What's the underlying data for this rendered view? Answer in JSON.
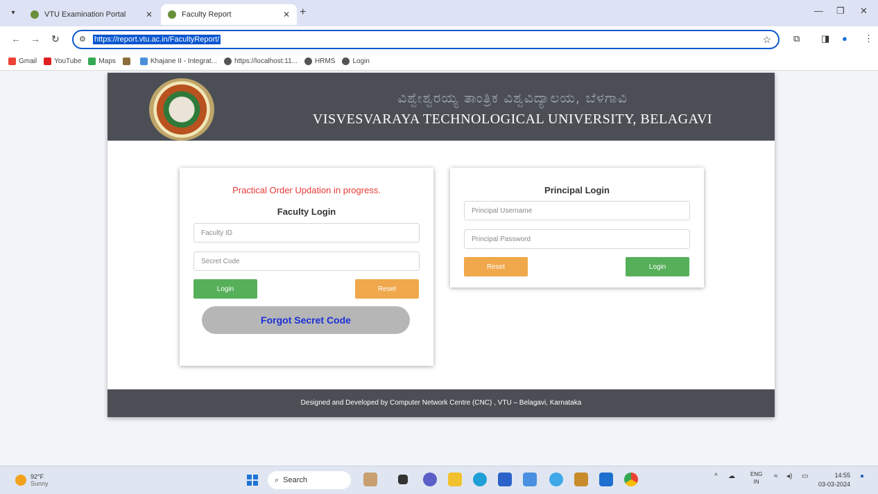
{
  "browser": {
    "tabs": [
      {
        "title": "VTU Examination Portal",
        "active": false
      },
      {
        "title": "Faculty Report",
        "active": true
      }
    ],
    "url": "https://report.vtu.ac.in/FacultyReport/",
    "bookmarks": [
      "Gmail",
      "YouTube",
      "Maps",
      "",
      "Khajane II - Integrat...",
      "https://localhost:11...",
      "HRMS",
      "Login"
    ]
  },
  "header": {
    "kannada_title": "ವಿಶ್ವೇಶ್ವರಯ್ಯ ತಾಂತ್ರಿಕ ವಿಶ್ವವಿದ್ಯಾಲಯ, ಬೆಳಗಾವಿ",
    "title": "VISVESVARAYA TECHNOLOGICAL UNIVERSITY, BELAGAVI"
  },
  "faculty_panel": {
    "notice": "Practical Order Updation in progress.",
    "title": "Faculty Login",
    "faculty_id_placeholder": "Faculty ID",
    "secret_code_placeholder": "Secret Code",
    "login_label": "Login",
    "reset_label": "Reset",
    "forgot_label": "Forgot Secret Code"
  },
  "principal_panel": {
    "title": "Principal Login",
    "username_placeholder": "Principal Username",
    "password_placeholder": "Principal Password",
    "reset_label": "Reset",
    "login_label": "Login"
  },
  "footer": {
    "text": "Designed and Developed by Computer Network Centre (CNC) , VTU – Belagavi, Karnataka"
  },
  "taskbar": {
    "weather_temp": "92°F",
    "weather_desc": "Sunny",
    "search_label": "Search",
    "lang": "ENG",
    "region": "IN",
    "time": "14:55",
    "date": "03-03-2024"
  },
  "colors": {
    "header_bg": "#4b4f55",
    "green": "#56b05a",
    "orange": "#efa84c",
    "notice_red": "#e53935",
    "forgot_blue": "#1a2fd6"
  }
}
